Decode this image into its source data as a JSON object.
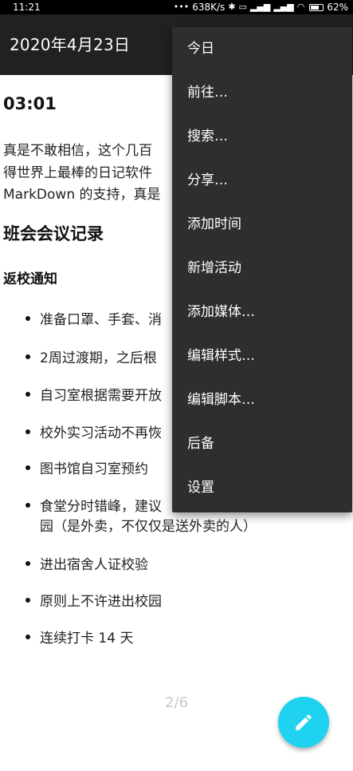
{
  "status_bar": {
    "time": "11:21",
    "net_speed": "638K/s",
    "battery": "62%"
  },
  "app_bar": {
    "title": "2020年4月23日"
  },
  "entry": {
    "time": "03:01",
    "paragraph_lines": [
      "真是不敢相信，这个几百",
      "得世界上最棒的日记软件",
      "MarkDown 的支持，真是"
    ],
    "heading": "班会会议记录",
    "subheading": "返校通知",
    "list_items": [
      "准备口罩、手套、消",
      "2周过渡期，之后根",
      "自习室根据需要开放",
      "校外实习活动不再恢",
      "图书馆自习室预约",
      "食堂分时错峰，建议",
      "园（是外卖，不仅仅是送外卖的人）",
      "进出宿舍人证校验",
      "原则上不许进出校园",
      "连续打卡 14 天"
    ]
  },
  "page_indicator": "2/6",
  "fab": {
    "icon": "pencil-icon",
    "color": "#1fd2f0"
  },
  "menu": {
    "items": [
      "今日",
      "前往…",
      "搜索…",
      "分享…",
      "添加时间",
      "新增活动",
      "添加媒体…",
      "编辑样式…",
      "编辑脚本…",
      "后备",
      "设置"
    ]
  }
}
